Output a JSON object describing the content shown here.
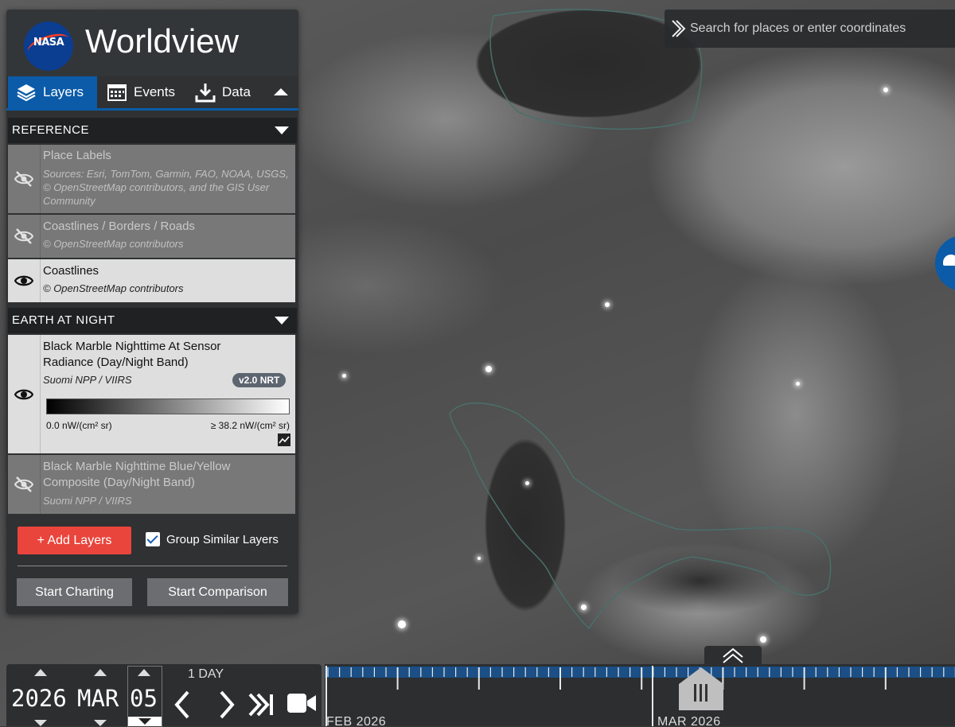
{
  "header": {
    "title": "Worldview",
    "logo_text": "NASA"
  },
  "tabs": [
    {
      "label": "Layers",
      "icon": "layers-icon",
      "active": true
    },
    {
      "label": "Events",
      "icon": "calendar-icon",
      "active": false
    },
    {
      "label": "Data",
      "icon": "download-icon",
      "active": false
    }
  ],
  "groups": {
    "reference": {
      "title": "REFERENCE",
      "layers": [
        {
          "name": "Place Labels",
          "source": "Sources: Esri, TomTom, Garmin, FAO, NOAA, USGS, © OpenStreetMap contributors, and the GIS User Community",
          "visible": false
        },
        {
          "name": "Coastlines / Borders / Roads",
          "source": "© OpenStreetMap contributors",
          "visible": false
        },
        {
          "name": "Coastlines",
          "source": "© OpenStreetMap contributors",
          "visible": true
        }
      ]
    },
    "earth_at_night": {
      "title": "EARTH AT NIGHT",
      "layers": [
        {
          "name": "Black Marble Nighttime At Sensor Radiance (Day/Night Band)",
          "source": "Suomi NPP / VIIRS",
          "badge": "v2.0 NRT",
          "visible": true,
          "legend_min": "0.0 nW/(cm² sr)",
          "legend_max": "≥ 38.2 nW/(cm² sr)"
        },
        {
          "name": "Black Marble Nighttime Blue/Yellow Composite (Day/Night Band)",
          "source": "Suomi NPP / VIIRS",
          "visible": false
        }
      ]
    }
  },
  "actions": {
    "add_layers": "+ Add Layers",
    "group_similar": "Group Similar Layers",
    "group_similar_checked": true,
    "start_charting": "Start Charting",
    "start_comparison": "Start Comparison"
  },
  "search": {
    "placeholder": "Search for places or enter coordinates"
  },
  "timeline": {
    "year": "2026",
    "month": "MAR",
    "day": "05",
    "interval": "1 DAY",
    "labels": [
      "FEB 2026",
      "MAR 2026"
    ]
  },
  "colors": {
    "accent": "#0b5ba8",
    "add_button": "#e9453c",
    "panel": "#2f3133"
  }
}
